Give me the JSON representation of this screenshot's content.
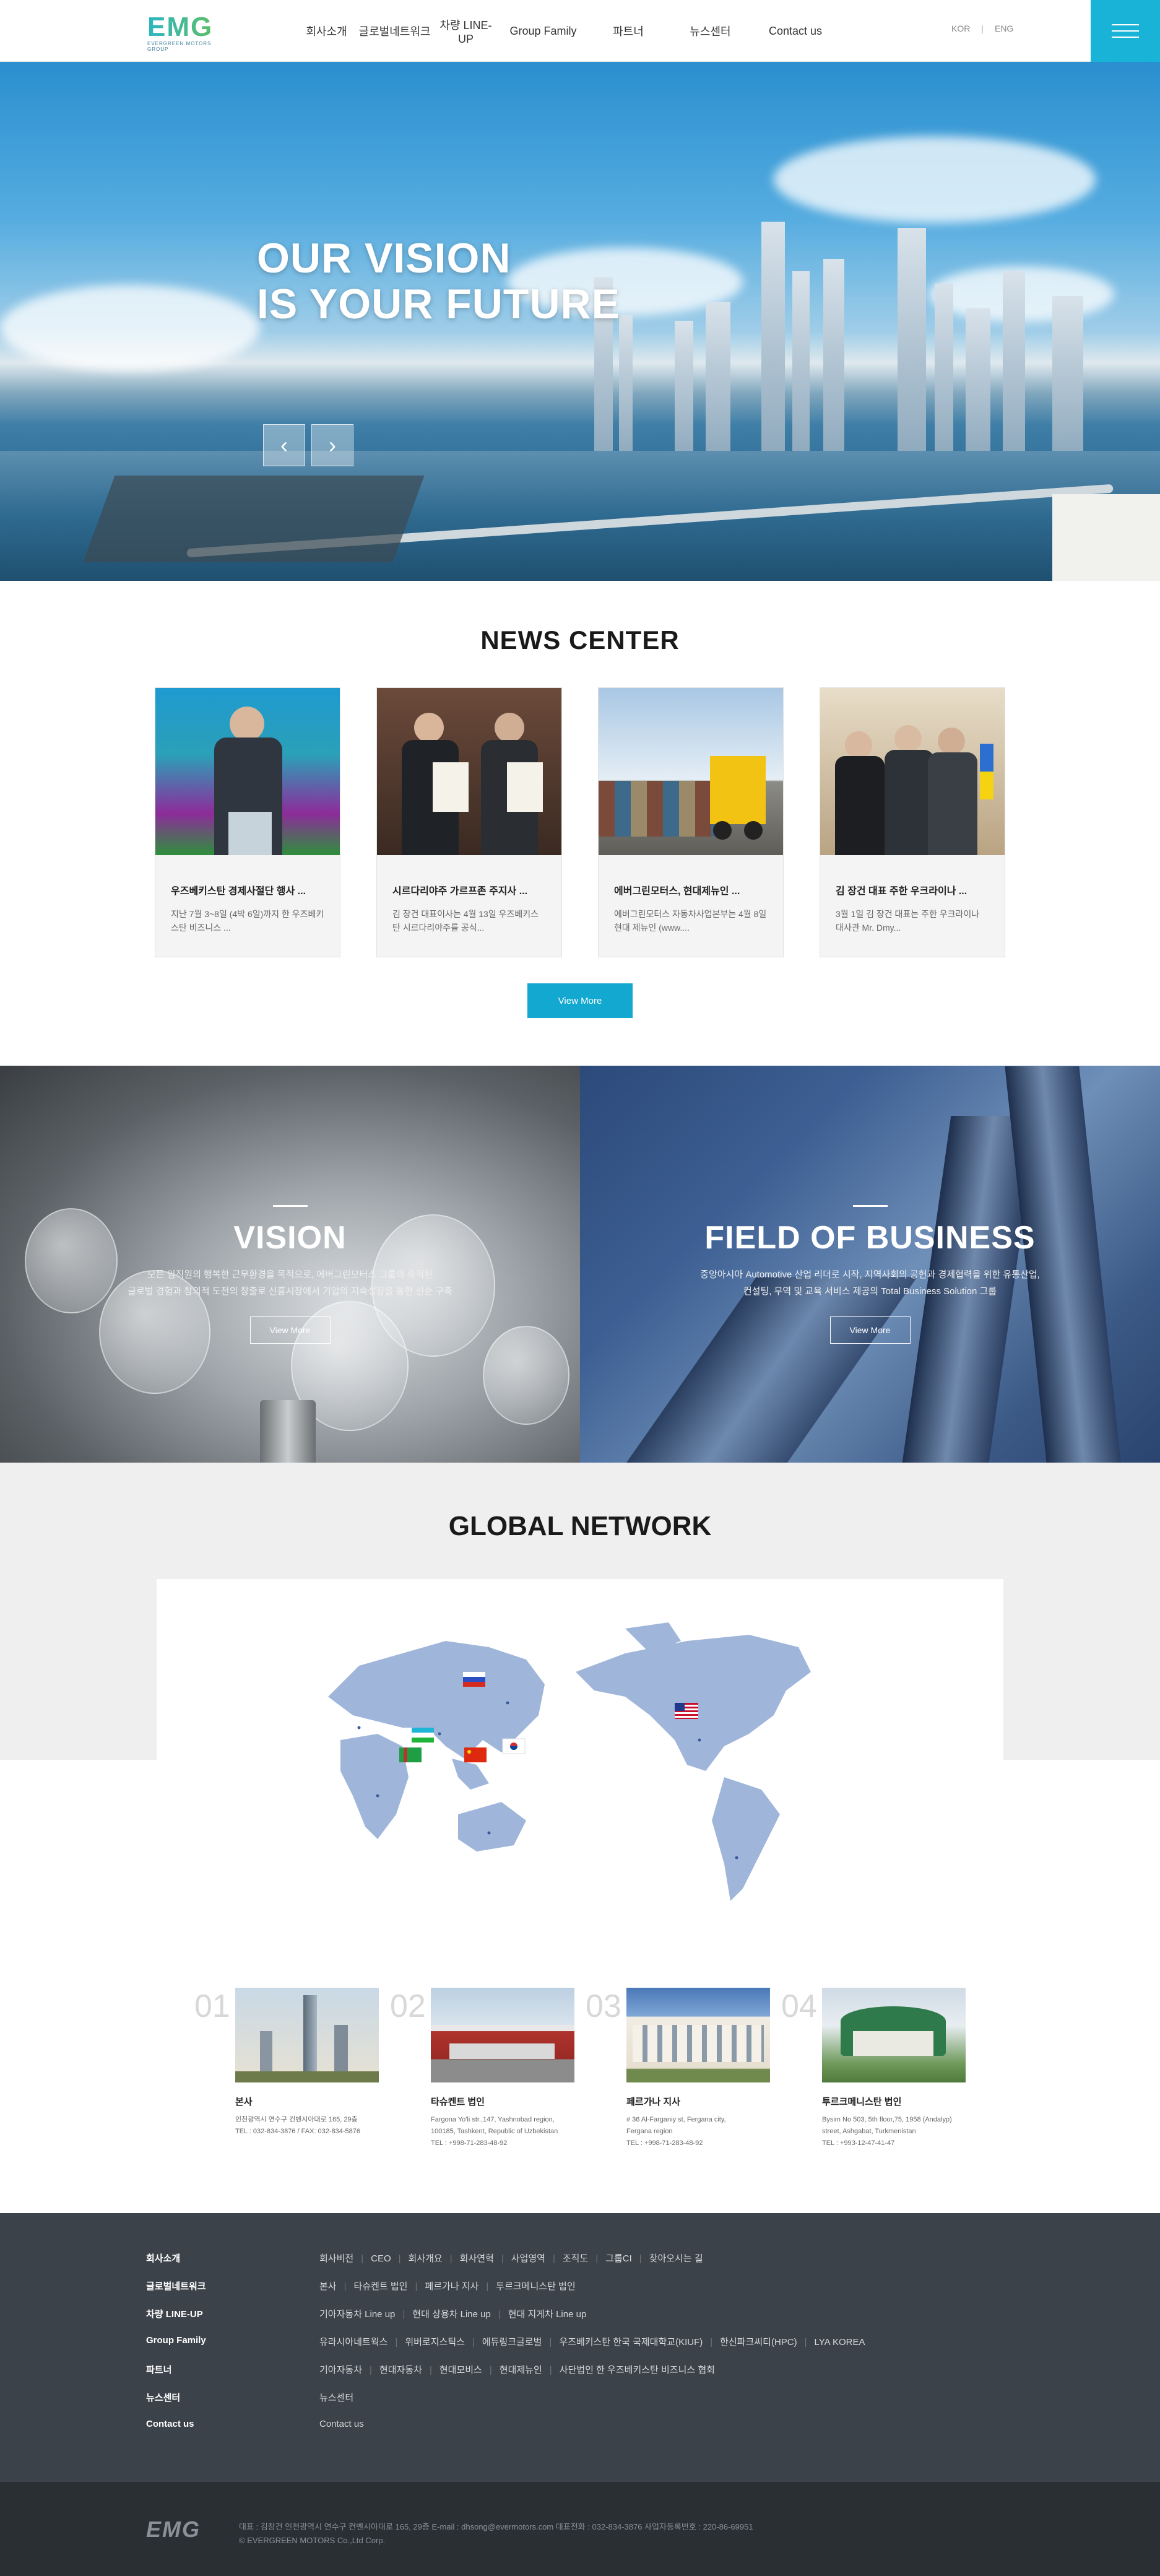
{
  "header": {
    "logo_text": "EMG",
    "logo_sub": "EVERGREEN MOTORS GROUP",
    "nav": [
      "회사소개",
      "글로벌네트워크",
      "차량 LINE-UP",
      "Group Family",
      "파트너",
      "뉴스센터",
      "Contact us"
    ],
    "lang": {
      "kor": "KOR",
      "eng": "ENG"
    },
    "accent": "#1ab3d8"
  },
  "hero": {
    "line1": "OUR VISION",
    "line2": "IS YOUR FUTURE",
    "prev": "‹",
    "next": "›"
  },
  "news": {
    "title": "NEWS CENTER",
    "items": [
      {
        "title": "우즈베키스탄 경제사절단 행사 ...",
        "desc": "지난 7월 3~8일 (4박 6일)까지 한 우즈베키스탄 비즈니스 ..."
      },
      {
        "title": "시르다리야주 가르프존 주지사 ...",
        "desc": "김 장건 대표이사는 4월 13일 우즈베키스탄 시르다리야주를 공식..."
      },
      {
        "title": "에버그린모터스, 현대제뉴인 ...",
        "desc": "에버그린모터스 자동차사업본부는 4월 8일 현대 제뉴인 (www...."
      },
      {
        "title": "김 장건 대표 주한 우크라이나 ...",
        "desc": "3월 1일 김 장건 대표는 주한 우크라이나 대사관 Mr. Dmy..."
      }
    ],
    "view_more": "View More"
  },
  "vision": {
    "title": "VISION",
    "desc1": "모든 임직원의 행복한 근무환경을 목적으로, 에버그린모터스 그룹의 축적된",
    "desc2": "글로벌 경험과 창의적 도전의 창출로 신흥시장에서 기업의 지속성장을 통한 선순 구축",
    "button": "View More"
  },
  "field": {
    "title": "FIELD OF BUSINESS",
    "desc1": "중앙아시아 Automotive 산업 리더로 시작, 지역사회의 공헌과 경제협력을 위한 유통산업,",
    "desc2": "컨설팅, 무역 및 교육 서비스 제공의 Total Business Solution 그룹",
    "button": "View More"
  },
  "network": {
    "title": "GLOBAL NETWORK"
  },
  "branches": [
    {
      "num": "01",
      "name": "본사",
      "addr1": "인천광역시 연수구 컨벤시아대로 165, 29층",
      "addr2": "TEL : 032-834-3876 / FAX: 032-834-5876",
      "addr3": ""
    },
    {
      "num": "02",
      "name": "타슈켄트 법인",
      "addr1": "Fargona Yo'li  str.,147, Yashnobad region,",
      "addr2": "100185, Tashkent, Republic of Uzbekistan",
      "addr3": "TEL : +998-71-283-48-92"
    },
    {
      "num": "03",
      "name": "페르가나 지사",
      "addr1": "# 36 Al-Farganiy st, Fergana city,",
      "addr2": "Fergana region",
      "addr3": "TEL : +998-71-283-48-92"
    },
    {
      "num": "04",
      "name": "투르크메니스탄 법인",
      "addr1": "Bysim No 503, 5th floor,75, 1958 (Andalyp)",
      "addr2": "street, Ashgabat, Turkmenistan",
      "addr3": "TEL : +993-12-47-41-47"
    }
  ],
  "footer": {
    "rows": [
      {
        "cat": "회사소개",
        "subs": [
          "회사비전",
          "CEO",
          "회사개요",
          "회사연혁",
          "사업영역",
          "조직도",
          "그룹CI",
          "찾아오시는 길"
        ]
      },
      {
        "cat": "글로벌네트워크",
        "subs": [
          "본사",
          "타슈켄트 법인",
          "페르가나 지사",
          "투르크메니스탄 법인"
        ]
      },
      {
        "cat": "차량 LINE-UP",
        "subs": [
          "기아자동차 Line up",
          "현대 상용차 Line up",
          "현대 지게차 Line up"
        ]
      },
      {
        "cat": "Group Family",
        "subs": [
          "유라시아네트웍스",
          "위버로지스틱스",
          "에듀링크글로벌",
          "우즈베키스탄 한국 국제대학교(KIUF)",
          "한신파크씨티(HPC)",
          "LYA KOREA"
        ]
      },
      {
        "cat": "파트너",
        "subs": [
          "기아자동차",
          "현대자동차",
          "현대모비스",
          "현대제뉴인",
          "사단법인 한 우즈베키스탄 비즈니스 협회"
        ]
      },
      {
        "cat": "뉴스센터",
        "subs": [
          "뉴스센터"
        ]
      },
      {
        "cat": "Contact us",
        "subs": [
          "Contact us"
        ]
      }
    ],
    "logo": "EMG",
    "info": "대표 : 김창건  인천광역시 연수구 컨벤시아대로 165, 29층  E-mail : dhsong@evermotors.com  대표전화 : 032-834-3876  사업자등록번호 : 220-86-69951",
    "copyright": "© EVERGREEN MOTORS Co.,Ltd Corp."
  }
}
